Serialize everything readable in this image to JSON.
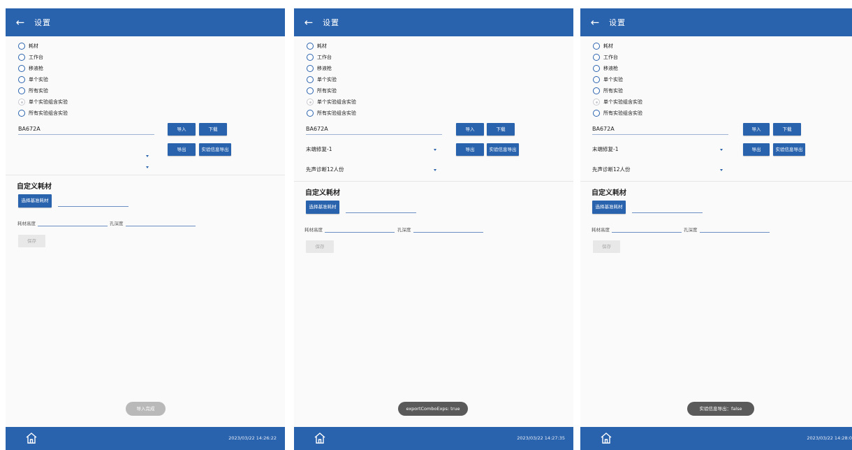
{
  "panels": [
    {
      "title": "设置",
      "radio_options": [
        "耗材",
        "工作台",
        "移液枪",
        "单个实验",
        "所有实验",
        "单个实验组含实验",
        "所有实验组含实验"
      ],
      "selected_option": "单个实验组含实验",
      "code_value": "BA672A",
      "dropdown1_value": "",
      "dropdown2_value": "",
      "buttons": {
        "import": "导入",
        "download": "下载",
        "export": "导出",
        "export_info": "实验信息导出"
      },
      "custom_title": "自定义耗材",
      "choose_base_button": "选择基准耗材",
      "height_label": "耗材高度",
      "depth_label": "孔深度",
      "save_button": "保存",
      "toast": "导入完成",
      "timestamp": "2023/03/22 14:26:22"
    },
    {
      "title": "设置",
      "radio_options": [
        "耗材",
        "工作台",
        "移液枪",
        "单个实验",
        "所有实验",
        "单个实验组含实验",
        "所有实验组含实验"
      ],
      "selected_option": "单个实验组含实验",
      "code_value": "BA672A",
      "dropdown1_value": "末端修复-1",
      "dropdown2_value": "先声诊断12人份",
      "buttons": {
        "import": "导入",
        "download": "下载",
        "export": "导出",
        "export_info": "实验信息导出"
      },
      "custom_title": "自定义耗材",
      "choose_base_button": "选择基准耗材",
      "height_label": "耗材高度",
      "depth_label": "孔深度",
      "save_button": "保存",
      "toast": "exportComboExps: true",
      "timestamp": "2023/03/22 14:27:35"
    },
    {
      "title": "设置",
      "radio_options": [
        "耗材",
        "工作台",
        "移液枪",
        "单个实验",
        "所有实验",
        "单个实验组含实验",
        "所有实验组含实验"
      ],
      "selected_option": "单个实验组含实验",
      "code_value": "BA672A",
      "dropdown1_value": "末端修复-1",
      "dropdown2_value": "先声诊断12人份",
      "buttons": {
        "import": "导入",
        "download": "下载",
        "export": "导出",
        "export_info": "实验信息导出"
      },
      "custom_title": "自定义耗材",
      "choose_base_button": "选择基准耗材",
      "height_label": "耗材高度",
      "depth_label": "孔深度",
      "save_button": "保存",
      "toast": "实验信息导出：false",
      "timestamp": "2023/03/22 14:28:0"
    }
  ],
  "colors": {
    "primary": "#2a63ad",
    "background": "#fafafa",
    "toast_light": "#b9b9b9",
    "toast_dark": "#5a5a5a"
  },
  "icons": {
    "back": "arrow-left-icon",
    "home": "home-icon",
    "dropdown": "caret-down-icon"
  }
}
